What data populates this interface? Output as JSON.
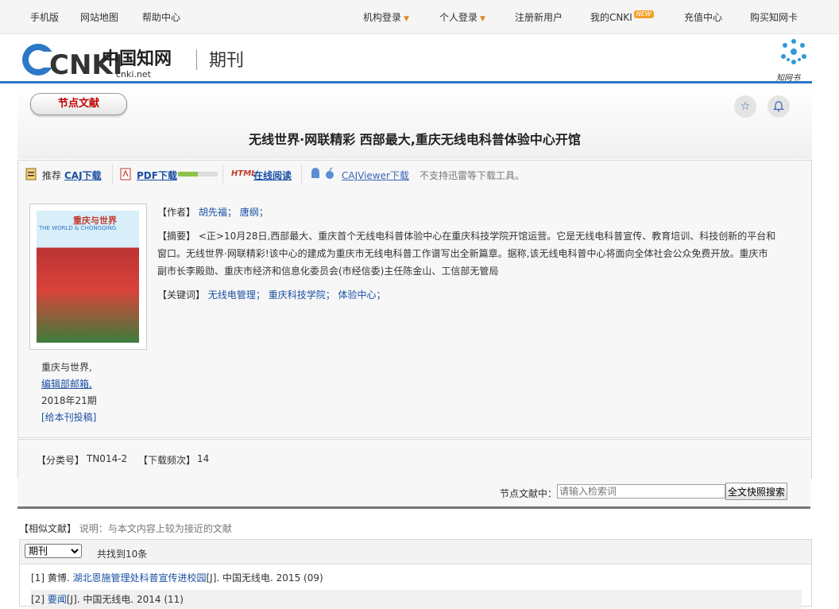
{
  "topnav": {
    "left": [
      "手机版",
      "网站地图",
      "帮助中心"
    ],
    "right": [
      {
        "label": "机构登录",
        "caret": true
      },
      {
        "label": "个人登录",
        "caret": true
      },
      {
        "label": "注册新用户"
      },
      {
        "label": "我的CNKI",
        "badge": "NEW"
      },
      {
        "label": "充值中心"
      },
      {
        "label": "购买知网卡"
      }
    ]
  },
  "header": {
    "logo_text": "CNKI",
    "logo_cn": "中国知网",
    "logo_url": "cnki.net",
    "section": "期刊",
    "app_label": "知网书"
  },
  "node": {
    "pill": "节点文献",
    "title": "无线世界·网联精彩 西部最大,重庆无线电科普体验中心开馆"
  },
  "download": {
    "recommend": "推荐",
    "caj": "CAJ下载",
    "pdf": "PDF下载",
    "pdf_progress": 0.5,
    "html_tag": "HTML",
    "online_read": "在线阅读",
    "viewer": "CAJViewer下载",
    "note": "不支持迅雷等下载工具。"
  },
  "magazine": {
    "cover_title_cn": "重庆与世界",
    "cover_title_en": "THE WORLD & CHONGQING",
    "name": "重庆与世界,",
    "dept": "编辑部邮箱,",
    "issue": "2018年21期",
    "submit": "[给本刊投稿]"
  },
  "article": {
    "authors_label": "【作者】",
    "authors": [
      "胡先福；",
      "唐纲；"
    ],
    "abstract_label": "【摘要】",
    "abstract": "<正>10月28日,西部最大、重庆首个无线电科普体验中心在重庆科技学院开馆运营。它是无线电科普宣传、教育培训、科技创新的平台和窗口。无线世界·网联精彩!该中心的建成为重庆市无线电科普工作谱写出全新篇章。据称,该无线电科普中心将面向全体社会公众免费开放。重庆市副市长李殿勋、重庆市经济和信息化委员会(市经信委)主任陈金山、工信部无管局",
    "keywords_label": "【关键词】",
    "keywords": [
      "无线电管理；",
      "重庆科技学院；",
      "体验中心；"
    ]
  },
  "classification": {
    "cls_label": "【分类号】",
    "cls_value": "TN014-2",
    "dl_label": "【下载频次】",
    "dl_value": "14"
  },
  "search": {
    "label": "节点文献中：",
    "placeholder": "请输入检索词",
    "button": "全文快照搜索"
  },
  "similar": {
    "heading": "【相似文献】",
    "desc": "说明：与本文内容上较为接近的文献",
    "select_value": "期刊",
    "found": "共找到10条",
    "items": [
      {
        "num": "[1]",
        "author": "黄博.",
        "title": "湖北恩施管理处科普宣传进校园",
        "source": "[J]. 中国无线电. 2015 (09)"
      },
      {
        "num": "[2]",
        "author": "",
        "title": "要闻",
        "source": "[J]. 中国无线电. 2014 (11)"
      }
    ]
  },
  "colors": {
    "accent_blue": "#2c78c7",
    "link": "#1a4fa3",
    "pill_red": "#c00000"
  }
}
